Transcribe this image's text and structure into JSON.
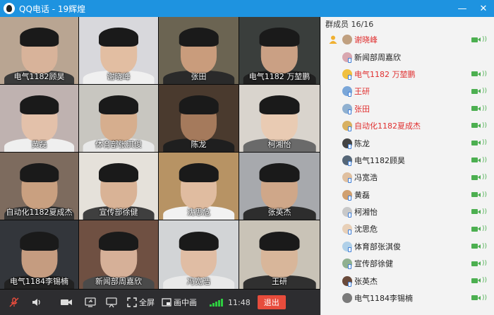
{
  "window": {
    "title": "QQ电话 - 19辉煌",
    "minimize": "—",
    "close": "✕"
  },
  "tiles": [
    {
      "name": "电气1182顾昊",
      "bg": "#b9a592",
      "skin": "#d8b39a",
      "shirt": "#3b3b3b"
    },
    {
      "name": "谢晓峰",
      "bg": "#d8d8dc",
      "skin": "#e2bea2",
      "shirt": "#f0f0f0"
    },
    {
      "name": "张田",
      "bg": "#6b6452",
      "skin": "#c99c7c",
      "shirt": "#2a2a2a"
    },
    {
      "name": "电气1182 万堃鹏",
      "bg": "#3a3e3c",
      "skin": "#caa084",
      "shirt": "#202020"
    },
    {
      "name": "黄磊",
      "bg": "#bfb2b0",
      "skin": "#e3c1aa",
      "shirt": "#efefef"
    },
    {
      "name": "体育部张淇俊",
      "bg": "#c8c6c0",
      "skin": "#d6ae8e",
      "shirt": "#e9e9e9"
    },
    {
      "name": "陈龙",
      "bg": "#4a3a2e",
      "skin": "#a57a5c",
      "shirt": "#1f1f1f"
    },
    {
      "name": "柯湘怡",
      "bg": "#d9d4cd",
      "skin": "#e9cbb3",
      "shirt": "#6a6a6a"
    },
    {
      "name": "自动化1182夏成杰",
      "bg": "#7d6b5e",
      "skin": "#c9a080",
      "shirt": "#353535"
    },
    {
      "name": "宣传部徐健",
      "bg": "#e5e1da",
      "skin": "#d9b396",
      "shirt": "#3f3f3f"
    },
    {
      "name": "沈思危",
      "bg": "#b79364",
      "skin": "#e0bca0",
      "shirt": "#f2f2f2"
    },
    {
      "name": "张英杰",
      "bg": "#a7a9ad",
      "skin": "#cfa789",
      "shirt": "#2d2d2d"
    },
    {
      "name": "电气1184李锡楠",
      "bg": "#33363b",
      "skin": "#c59c80",
      "shirt": "#222222"
    },
    {
      "name": "新闻部周嘉欣",
      "bg": "#6f5042",
      "skin": "#d6b098",
      "shirt": "#4a4a4a"
    },
    {
      "name": "冯宽浩",
      "bg": "#d2d4d6",
      "skin": "#e0bda4",
      "shirt": "#e9e9e9"
    },
    {
      "name": "王研",
      "bg": "#c9c3b7",
      "skin": "#d8b69a",
      "shirt": "#303030"
    }
  ],
  "toolbar": {
    "fullscreen_label": "全屏",
    "pip_label": "画中画",
    "time": "11:48",
    "hangup_label": "退出"
  },
  "panel": {
    "title": "群成员 16/16",
    "members": [
      {
        "name": "谢晓峰",
        "red": true,
        "host": true,
        "camera": true,
        "avatar": "#c0a080",
        "mobile": false
      },
      {
        "name": "新闻部周嘉欣",
        "red": false,
        "host": false,
        "camera": false,
        "avatar": "#d9a7b0",
        "mobile": true
      },
      {
        "name": "电气1182 万堃鹏",
        "red": true,
        "host": false,
        "camera": true,
        "avatar": "#f0c040",
        "mobile": true
      },
      {
        "name": "王研",
        "red": true,
        "host": false,
        "camera": true,
        "avatar": "#7aa6d8",
        "mobile": true
      },
      {
        "name": "张田",
        "red": true,
        "host": false,
        "camera": true,
        "avatar": "#8fb0d0",
        "mobile": true
      },
      {
        "name": "自动化1182夏成杰",
        "red": true,
        "host": false,
        "camera": true,
        "avatar": "#d8b060",
        "mobile": true
      },
      {
        "name": "陈龙",
        "red": false,
        "host": false,
        "camera": true,
        "avatar": "#444444",
        "mobile": true
      },
      {
        "name": "电气1182顾昊",
        "red": false,
        "host": false,
        "camera": true,
        "avatar": "#556677",
        "mobile": true
      },
      {
        "name": "冯宽浩",
        "red": false,
        "host": false,
        "camera": true,
        "avatar": "#e0c0a0",
        "mobile": true
      },
      {
        "name": "黄磊",
        "red": false,
        "host": false,
        "camera": true,
        "avatar": "#d0a070",
        "mobile": true
      },
      {
        "name": "柯湘怡",
        "red": false,
        "host": false,
        "camera": true,
        "avatar": "#c8c8c8",
        "mobile": true
      },
      {
        "name": "沈思危",
        "red": false,
        "host": false,
        "camera": true,
        "avatar": "#e8d0b8",
        "mobile": true
      },
      {
        "name": "体育部张淇俊",
        "red": false,
        "host": false,
        "camera": true,
        "avatar": "#b0d0e8",
        "mobile": true
      },
      {
        "name": "宣传部徐健",
        "red": false,
        "host": false,
        "camera": true,
        "avatar": "#90b090",
        "mobile": true
      },
      {
        "name": "张英杰",
        "red": false,
        "host": false,
        "camera": true,
        "avatar": "#6a4a3a",
        "mobile": true
      },
      {
        "name": "电气1184李锡楠",
        "red": false,
        "host": false,
        "camera": true,
        "avatar": "#7a7a7a",
        "mobile": false
      }
    ]
  },
  "colors": {
    "accent": "#1e93e0",
    "hangup": "#e74c3c",
    "camera_on": "#4caf50",
    "highlight_name": "#e03030"
  }
}
